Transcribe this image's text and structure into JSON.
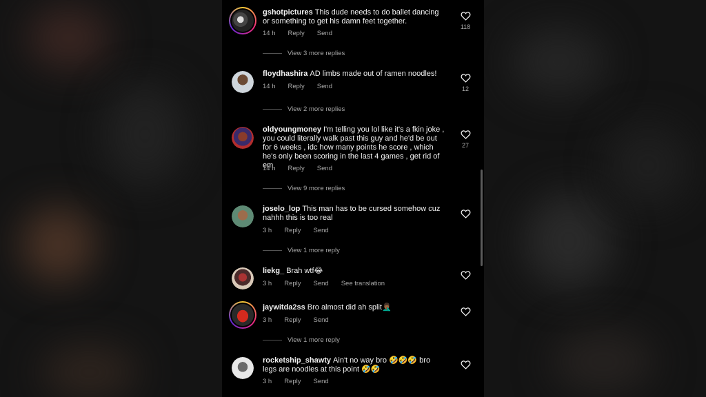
{
  "colors": {
    "background": "#000000",
    "text": "#f2f2f2",
    "muted": "#a8a8a8",
    "story_ring_start": "#f9ce34",
    "story_ring_mid": "#ee2a7b",
    "story_ring_end": "#6228d7"
  },
  "comments": [
    {
      "username": "gshotpictures",
      "text": "This dude needs to do ballet dancing or something to get his damn feet together.",
      "time": "14 h",
      "reply": "Reply",
      "send": "Send",
      "likes": "118",
      "more_replies": "View 3 more replies"
    },
    {
      "username": "floydhashira",
      "text": "AD limbs made out of ramen noodles!",
      "time": "14 h",
      "reply": "Reply",
      "send": "Send",
      "likes": "12",
      "more_replies": "View 2 more replies"
    },
    {
      "username": "oldyoungmoney",
      "text": "I'm telling you lol like it's a fkin joke , you could literally walk past this guy and he'd be out for 6 weeks , idc how many points he score , which he's only been scoring in the last 4 games , get rid of em",
      "time": "14 h",
      "reply": "Reply",
      "send": "Send",
      "likes": "27",
      "more_replies": "View 9 more replies"
    },
    {
      "username": "joselo_lop",
      "text": "This man has to be cursed somehow cuz nahhh this is too real",
      "time": "3 h",
      "reply": "Reply",
      "send": "Send",
      "more_replies": "View 1 more reply"
    },
    {
      "username": "liekg_",
      "text": "Brah wtf😂",
      "time": "3 h",
      "reply": "Reply",
      "send": "Send",
      "translate": "See translation"
    },
    {
      "username": "jaywitda2ss",
      "text": "Bro almost did ah split🤦🏾‍♂️",
      "time": "3 h",
      "reply": "Reply",
      "send": "Send",
      "more_replies": "View 1 more reply"
    },
    {
      "username": "rocketship_shawty",
      "text": "Ain't no way bro 🤣🤣🤣 bro legs are noodles at this point 🤣🤣",
      "time": "3 h",
      "reply": "Reply",
      "send": "Send"
    }
  ]
}
